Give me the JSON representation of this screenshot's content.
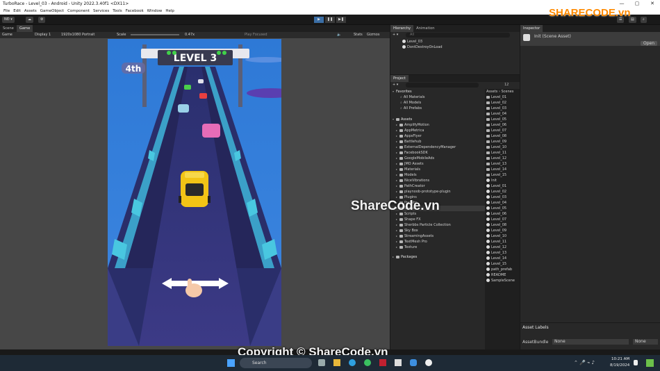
{
  "window": {
    "title": "TurboRace - Level_03 - Android - Unity 2022.3.40f1 <DX11>",
    "controls": [
      "—",
      "▢",
      "✕"
    ]
  },
  "menu": [
    "File",
    "Edit",
    "Assets",
    "GameObject",
    "Component",
    "Services",
    "Tools",
    "Facebook",
    "Window",
    "Help"
  ],
  "toolbar": {
    "account": "NĐ ▾",
    "play": "▶",
    "pause": "❚❚",
    "step": "▶❚"
  },
  "scene_tabs": [
    "Scene",
    "Game"
  ],
  "game_bar": {
    "mode": "Game",
    "display": "Display 1",
    "resolution": "1920x1080 Portrait",
    "scale_label": "Scale",
    "scale_value": "0.47x",
    "play_focused": "Play Focused",
    "stats": "Stats",
    "gizmos": "Gizmos"
  },
  "game_view": {
    "banner": "LEVEL 3",
    "position": "4th"
  },
  "hierarchy": {
    "tab": "Hierarchy",
    "tab2": "Animation",
    "search": "All",
    "items": [
      "Level_03",
      "DontDestroyOnLoad"
    ]
  },
  "inspector": {
    "tab": "Inspector",
    "object": "Init (Scene Asset)",
    "open_button": "Open",
    "labels_title": "Asset Labels",
    "asset_bundle": "AssetBundle",
    "bundle_value": "None",
    "bundle_variant": "None"
  },
  "project": {
    "tab": "Project",
    "count": "12",
    "favorites_title": "Favorites",
    "favorites": [
      "All Materials",
      "All Models",
      "All Prefabs"
    ],
    "assets_title": "Assets",
    "folders": [
      "AmplifyMotion",
      "AppMetrica",
      "AppsFlyer",
      "Battlehub",
      "ExternalDependencyManager",
      "FacebookSDK",
      "GoogleMobileAds",
      "JMO Assets",
      "Materials",
      "Models",
      "NiceVibrations",
      "PathCreator",
      "playnoob-prototype-plugin",
      "Plugins",
      "Prefabs",
      "Scenes",
      "Scripts",
      "Shape FX",
      "Sherbbs Particle Collection",
      "Sky Box",
      "StreamingAssets",
      "TextMesh Pro",
      "Texture"
    ],
    "packages_title": "Packages",
    "breadcrumb": [
      "Assets",
      "Scenes"
    ],
    "files": [
      "Level_01",
      "Level_02",
      "Level_03",
      "Level_04",
      "Level_05",
      "Level_06",
      "Level_07",
      "Level_08",
      "Level_09",
      "Level_10",
      "Level_11",
      "Level_12",
      "Level_13",
      "Level_14",
      "Level_15",
      "Init",
      "Level_01",
      "Level_02",
      "Level_03",
      "Level_04",
      "Level_05",
      "Level_06",
      "Level_07",
      "Level_08",
      "Level_09",
      "Level_10",
      "Level_11",
      "Level_12",
      "Level_13",
      "Level_14",
      "Level_15",
      "path_prefab",
      "README",
      "SampleScene"
    ]
  },
  "watermark": {
    "logo": "SHARECODE.vn",
    "center": "ShareCode.vn",
    "copyright": "Copyright © ShareCode.vn"
  },
  "taskbar": {
    "search": "Search",
    "time": "10:21 AM",
    "date": "8/19/2024"
  }
}
